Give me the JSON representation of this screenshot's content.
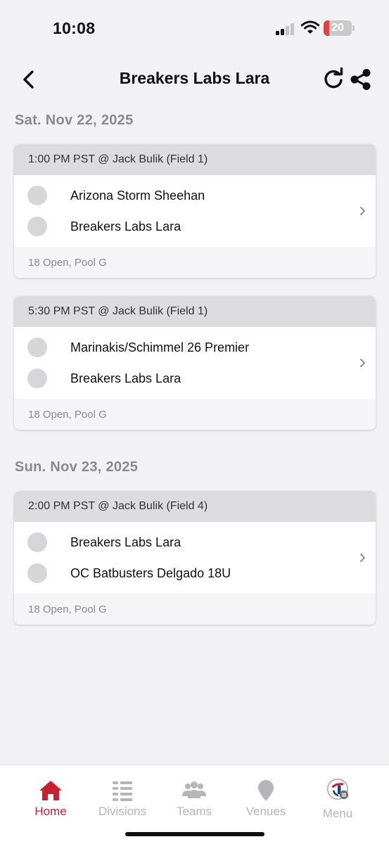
{
  "status_bar": {
    "time": "10:08",
    "battery": "20",
    "battery_level": 0.2
  },
  "header": {
    "title": "Breakers Labs Lara"
  },
  "schedule": [
    {
      "date": "Sat. Nov 22, 2025",
      "games": [
        {
          "time_venue": "1:00 PM PST @ Jack Bulik (Field 1)",
          "team1": "Arizona Storm Sheehan",
          "team2": "Breakers Labs Lara",
          "division": "18 Open, Pool G"
        },
        {
          "time_venue": "5:30 PM PST @ Jack Bulik (Field 1)",
          "team1": "Marinakis/Schimmel 26 Premier",
          "team2": "Breakers Labs Lara",
          "division": "18 Open, Pool G"
        }
      ]
    },
    {
      "date": "Sun. Nov 23, 2025",
      "games": [
        {
          "time_venue": "2:00 PM PST @ Jack Bulik (Field 4)",
          "team1": "Breakers Labs Lara",
          "team2": "OC Batbusters Delgado 18U",
          "division": "18 Open, Pool G"
        }
      ]
    }
  ],
  "tabs": [
    {
      "label": "Home",
      "icon": "home-icon",
      "active": true
    },
    {
      "label": "Divisions",
      "icon": "list-icon",
      "active": false
    },
    {
      "label": "Teams",
      "icon": "people-icon",
      "active": false
    },
    {
      "label": "Venues",
      "icon": "location-pin-icon",
      "active": false
    },
    {
      "label": "Menu",
      "icon": "menu-logo-icon",
      "active": false
    }
  ],
  "colors": {
    "accent": "#c8202e",
    "inactive": "#b6b6ba",
    "background": "#f2f2f4",
    "card_header": "#dcdcde",
    "battery_low": "#e5403a"
  }
}
